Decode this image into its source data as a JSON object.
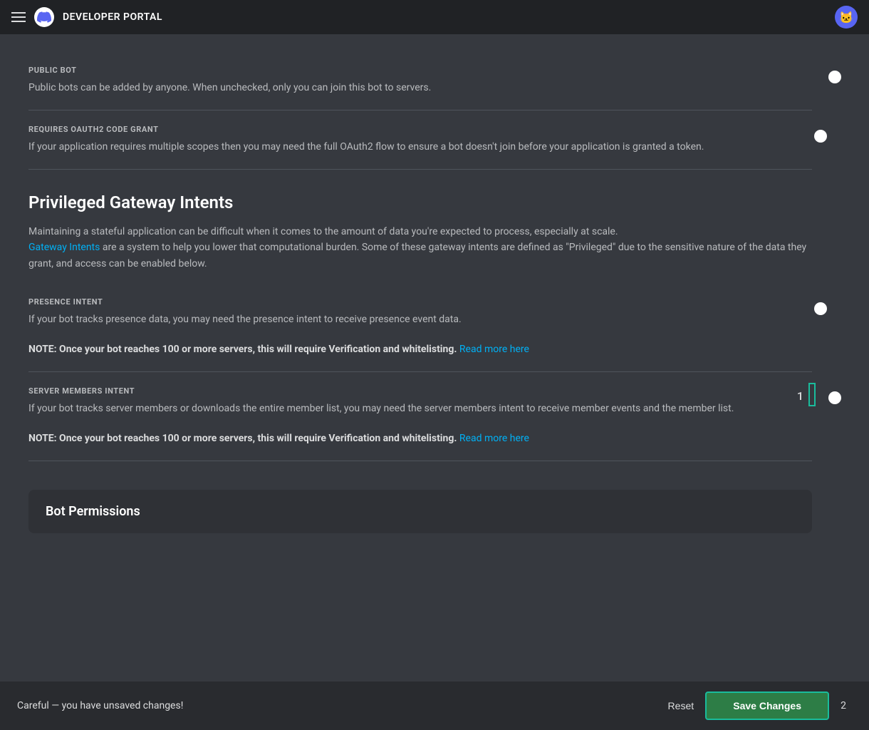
{
  "nav": {
    "portal_title": "DEVELOPER PORTAL",
    "hamburger_label": "Menu"
  },
  "sections": {
    "public_bot": {
      "label": "PUBLIC BOT",
      "description": "Public bots can be added by anyone. When unchecked, only you can join this bot to servers.",
      "toggle_on": true
    },
    "oauth2_code_grant": {
      "label": "REQUIRES OAUTH2 CODE GRANT",
      "description": "If your application requires multiple scopes then you may need the full OAuth2 flow to ensure a bot doesn't join before your application is granted a token.",
      "toggle_on": false
    }
  },
  "privileged_gateway": {
    "heading": "Privileged Gateway Intents",
    "description_part1": "Maintaining a stateful application can be difficult when it comes to the amount of data you're expected to process, especially at scale.",
    "gateway_intents_link_text": "Gateway Intents",
    "description_part2": " are a system to help you lower that computational burden. Some of these gateway intents are defined as \"Privileged\" due to the sensitive nature of the data they grant, and access can be enabled below.",
    "presence_intent": {
      "label": "PRESENCE INTENT",
      "description": "If your bot tracks presence data, you may need the presence intent to receive presence event data.",
      "note": "NOTE: Once your bot reaches 100 or more servers, this will require Verification and whitelisting.",
      "read_more_link": "Read more here",
      "toggle_on": false
    },
    "server_members_intent": {
      "label": "SERVER MEMBERS INTENT",
      "description": "If your bot tracks server members or downloads the entire member list, you may need the server members intent to receive member events and the member list.",
      "note": "NOTE: Once your bot reaches 100 or more servers, this will require Verification and whitelisting.",
      "read_more_link": "Read more here",
      "toggle_on": true,
      "badge_number": "1",
      "highlighted": true
    }
  },
  "bot_permissions": {
    "heading": "Bot Permissions"
  },
  "bottom_bar": {
    "warning": "Careful — you have unsaved changes!",
    "reset_label": "Reset",
    "save_label": "Save Changes",
    "badge_number": "2"
  },
  "colors": {
    "toggle_on": "#3ba55c",
    "toggle_off": "#72767d",
    "link": "#00b0f4",
    "highlight_border": "#1abc9c",
    "save_bg": "#2d7d46"
  }
}
